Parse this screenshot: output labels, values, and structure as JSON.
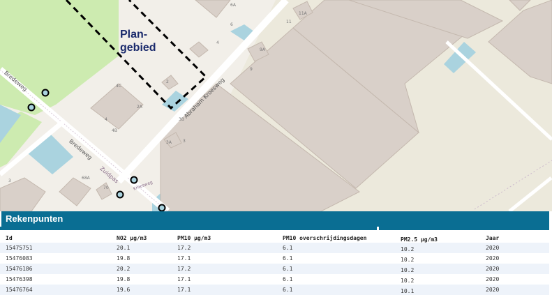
{
  "map": {
    "plan_label_line1": "Plan-",
    "plan_label_line2": "gebied",
    "streets": {
      "bredeweg_1": "Bredeweg",
      "bredeweg_2": "Bredeweg",
      "abraham": "Abraham Kroesweg",
      "zuidpas": "Zuidpas",
      "kroesweg_small": "Kroesweg"
    },
    "house_numbers": {
      "n6a": "6A",
      "n11a": "11A",
      "n6": "6",
      "n4": "4",
      "n11": "11",
      "n9a": "9A",
      "n9": "9",
      "n4c": "4C",
      "n2a": "2A",
      "n4b": "4B",
      "n4x": "4",
      "n2": "2",
      "n3b": "3B",
      "n3a": "3A",
      "n3": "3",
      "n68a": "68A",
      "n70": "70",
      "n3s": "3"
    },
    "colors": {
      "background": "#f2efe9",
      "building": "#d9d0c9",
      "building_stroke": "#c4b8ae",
      "industrial": "#ece9dc",
      "grass": "#cdebb0",
      "water": "#aad3df",
      "road": "#ffffff",
      "plan_border": "#000000",
      "marker_fill": "#aad3df"
    },
    "markers_count_shown": 5
  },
  "panel": {
    "title": "Rekenpunten",
    "header_color": "#0a6e93",
    "columns": [
      "Id",
      "NO2 µg/m3",
      "PM10 µg/m3",
      "PM10 overschrijdingsdagen",
      "PM2.5 µg/m3",
      "Jaar"
    ],
    "rows": [
      [
        "15475751",
        "20.1",
        "17.2",
        "6.1",
        "10.2",
        "2020"
      ],
      [
        "15476083",
        "19.8",
        "17.1",
        "6.1",
        "10.2",
        "2020"
      ],
      [
        "15476186",
        "20.2",
        "17.2",
        "6.1",
        "10.2",
        "2020"
      ],
      [
        "15476398",
        "19.8",
        "17.1",
        "6.1",
        "10.2",
        "2020"
      ],
      [
        "15476764",
        "19.6",
        "17.1",
        "6.1",
        "10.1",
        "2020"
      ]
    ]
  }
}
